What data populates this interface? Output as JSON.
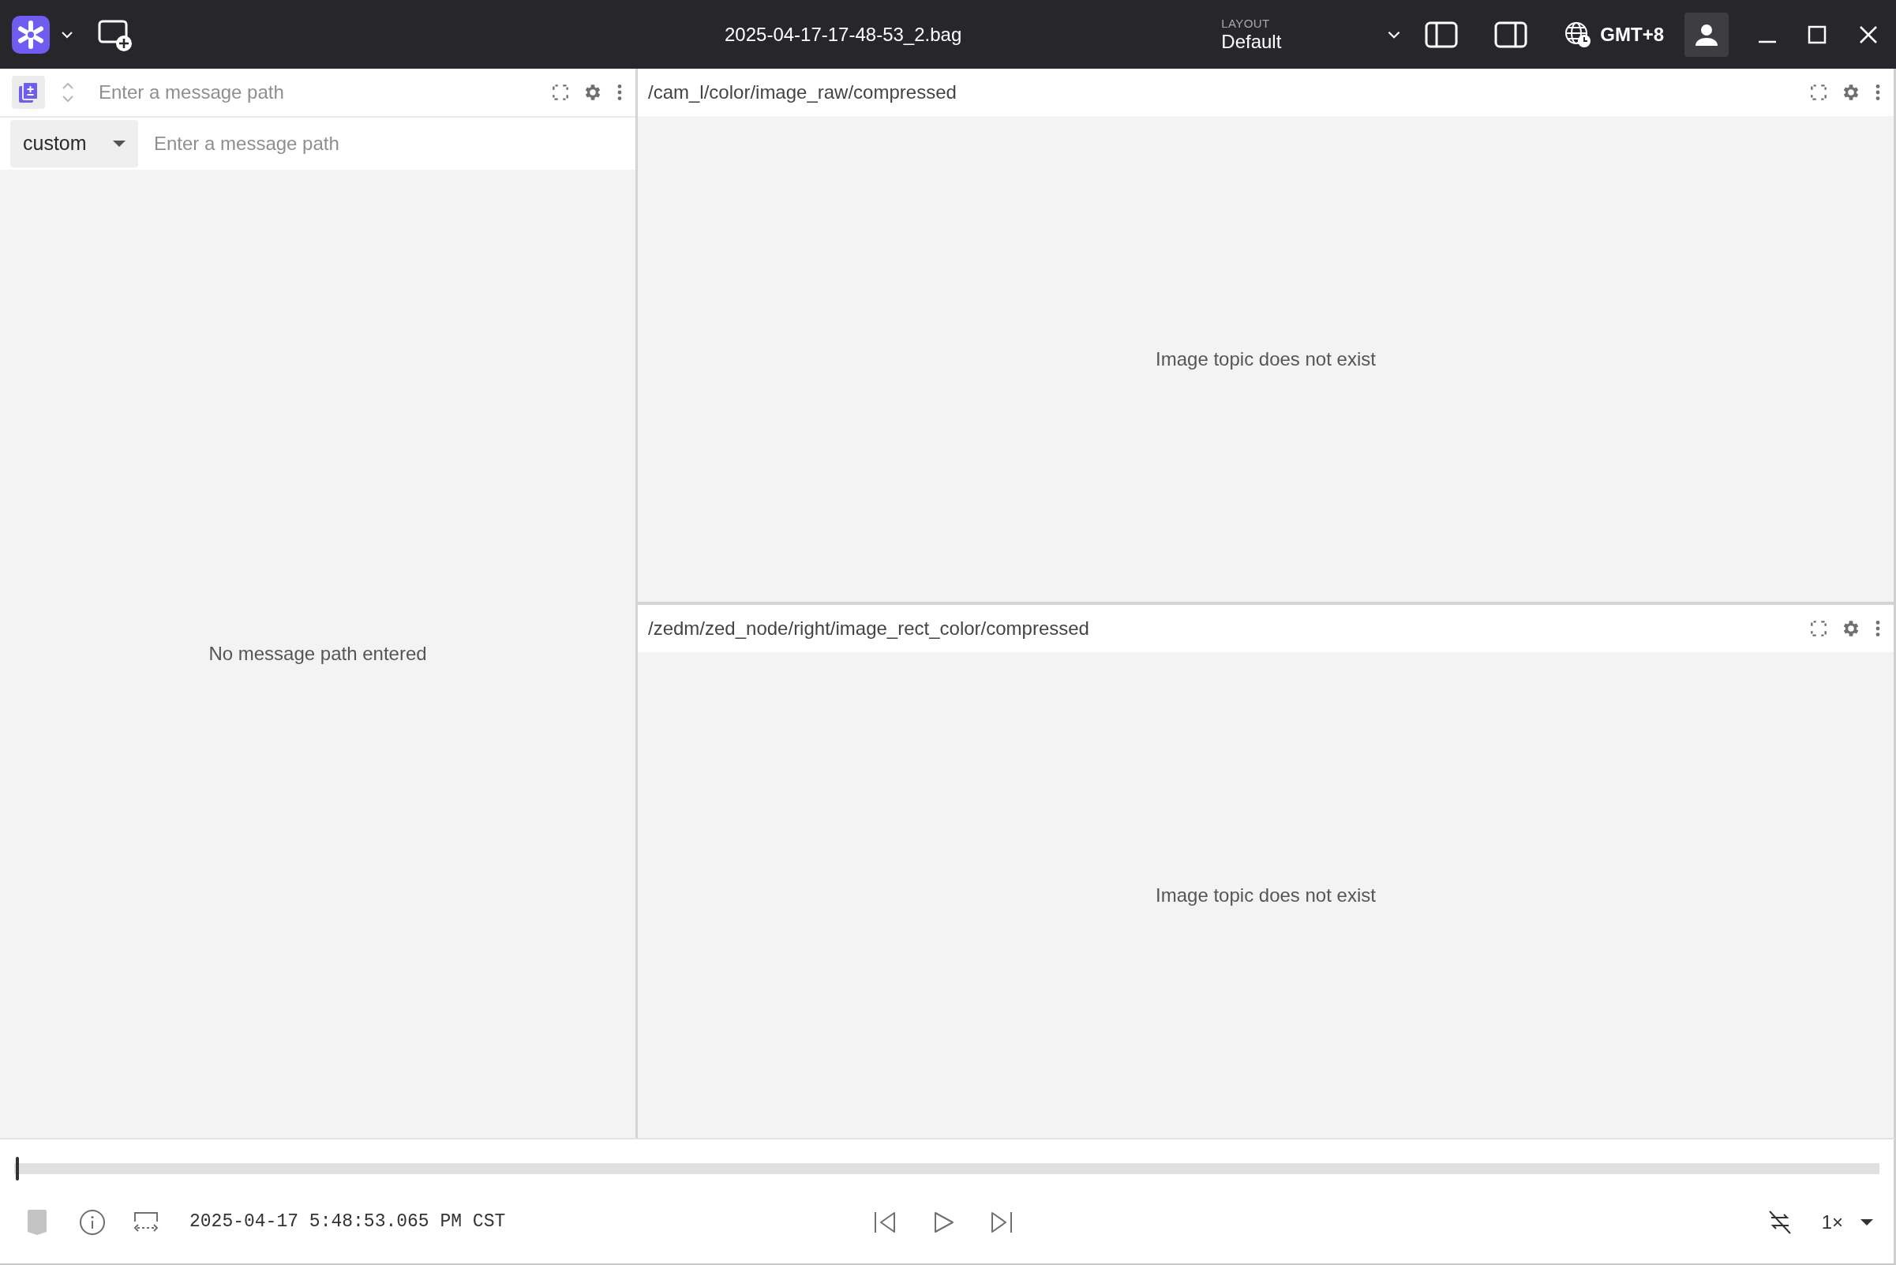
{
  "app_bar": {
    "title": "2025-04-17-17-48-53_2.bag",
    "layout_label": "LAYOUT",
    "layout_name": "Default",
    "timezone": "GMT+8"
  },
  "plot_panel": {
    "path_placeholder": "Enter a message path",
    "series": [
      {
        "type_label": "custom",
        "placeholder": "Enter a message path"
      }
    ],
    "empty_message": "No message path entered"
  },
  "image_panels": [
    {
      "topic": "/cam_l/color/image_raw/compressed",
      "message": "Image topic does not exist"
    },
    {
      "topic": "/zedm/zed_node/right/image_rect_color/compressed",
      "message": "Image topic does not exist"
    }
  ],
  "playback": {
    "level": 0,
    "timestamp": "2025-04-17 5:48:53.065 PM CST",
    "loop": false,
    "speed": "1×"
  }
}
